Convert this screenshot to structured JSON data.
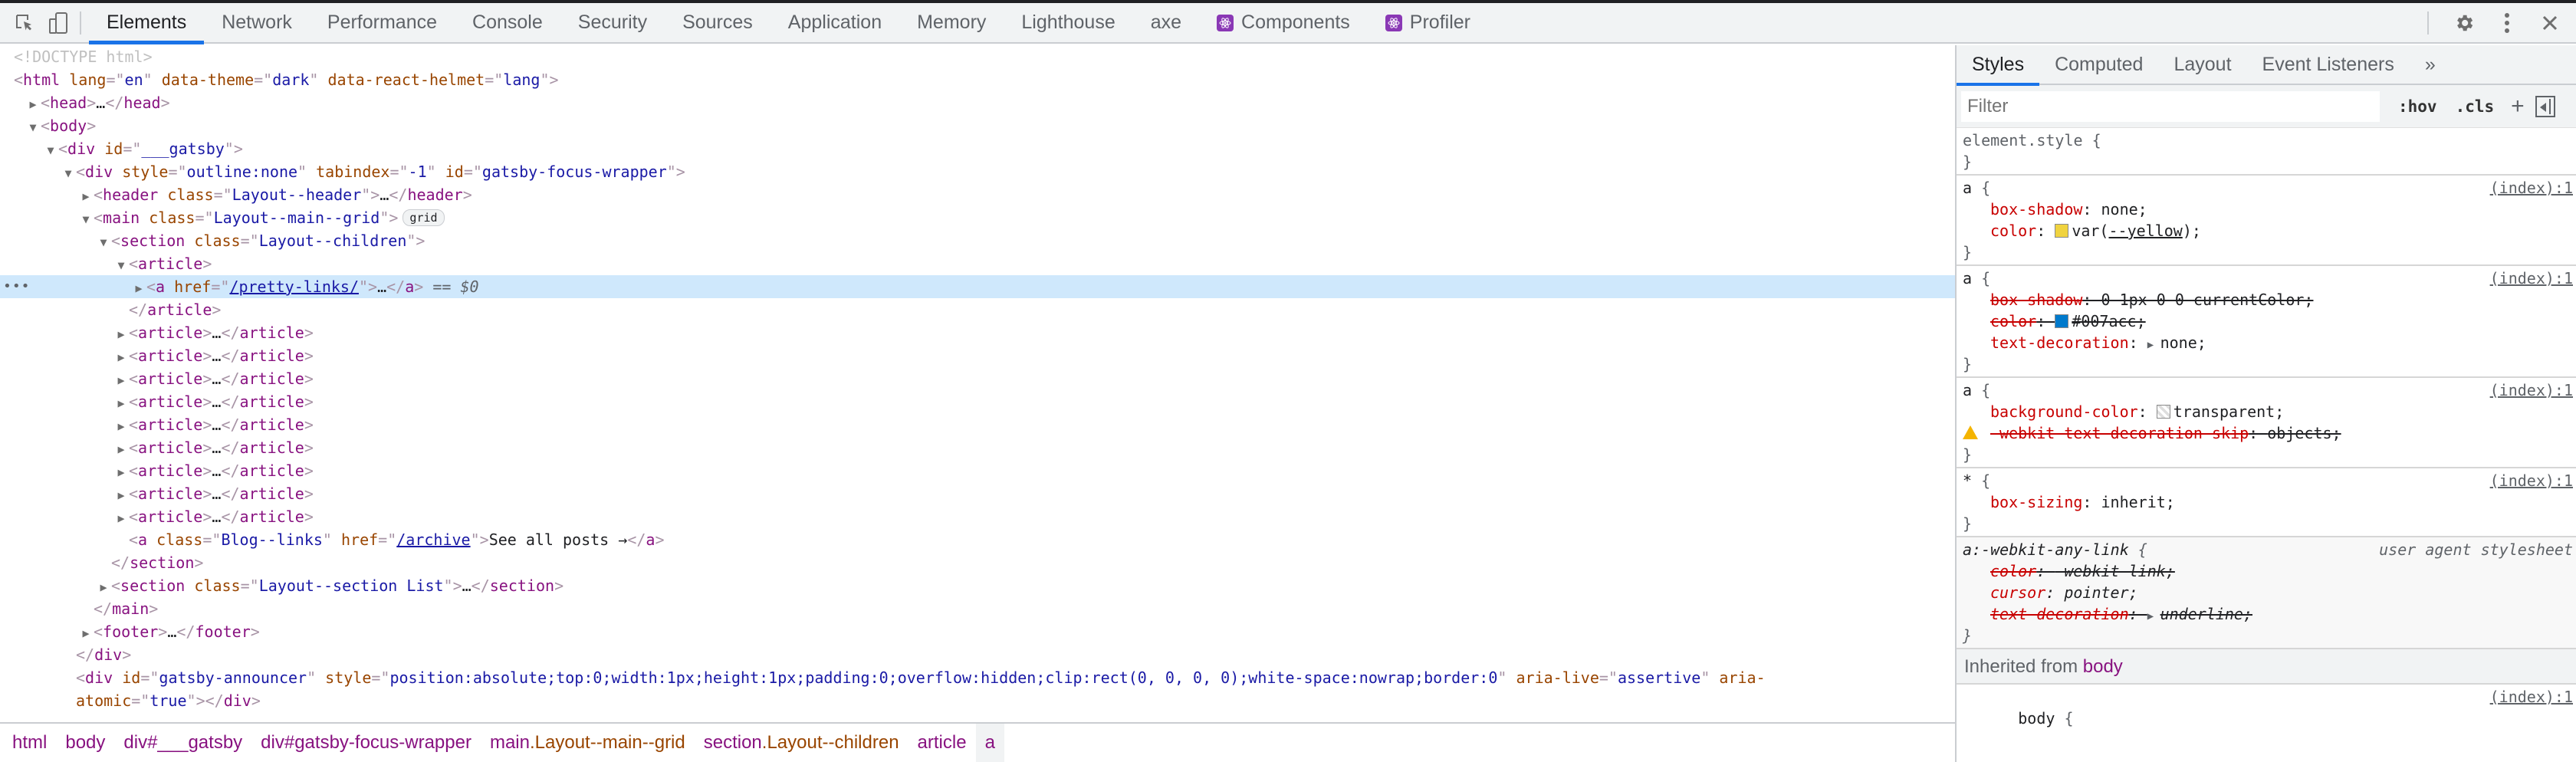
{
  "toolbar": {
    "inspect_icon": "element-picker-icon",
    "device_icon": "device-toolbar-icon",
    "tabs": [
      {
        "label": "Elements",
        "active": true
      },
      {
        "label": "Network"
      },
      {
        "label": "Performance"
      },
      {
        "label": "Console"
      },
      {
        "label": "Security"
      },
      {
        "label": "Sources"
      },
      {
        "label": "Application"
      },
      {
        "label": "Memory"
      },
      {
        "label": "Lighthouse"
      },
      {
        "label": "axe"
      },
      {
        "label": "Components",
        "icon": "react-icon"
      },
      {
        "label": "Profiler",
        "icon": "react-icon"
      }
    ],
    "right_icons": [
      "gear-icon",
      "kebab-menu-icon",
      "close-icon"
    ]
  },
  "elements": {
    "doctype": "<!DOCTYPE html>",
    "html_tag": {
      "name": "html",
      "attrs": [
        {
          "n": "lang",
          "v": "en"
        },
        {
          "n": "data-theme",
          "v": "dark"
        },
        {
          "n": "data-react-helmet",
          "v": "lang"
        }
      ]
    },
    "head": "head",
    "body": "body",
    "gatsby_div": {
      "name": "div",
      "attr_n": "id",
      "attr_v": "___gatsby"
    },
    "focus_wrapper": {
      "name": "div",
      "attrs": [
        {
          "n": "style",
          "v": "outline:none"
        },
        {
          "n": "tabindex",
          "v": "-1"
        },
        {
          "n": "id",
          "v": "gatsby-focus-wrapper"
        }
      ]
    },
    "header": {
      "name": "header",
      "attr_n": "class",
      "attr_v": "Layout--header"
    },
    "main": {
      "name": "main",
      "attr_n": "class",
      "attr_v": "Layout--main--grid",
      "badge": "grid"
    },
    "section": {
      "name": "section",
      "attr_n": "class",
      "attr_v": "Layout--children"
    },
    "article": "article",
    "selected_link": {
      "name": "a",
      "attr_n": "href",
      "attr_v": "/pretty-links/",
      "marker": "== $0"
    },
    "collapsed_article_count": 9,
    "blog_link": {
      "name": "a",
      "class_v": "Blog--links",
      "href_v": "/archive",
      "text": "See all posts →"
    },
    "section_list": {
      "name": "section",
      "attr_n": "class",
      "attr_v": "Layout--section List"
    },
    "footer": "footer",
    "announcer": {
      "id": "gatsby-announcer",
      "style": "position:absolute;top:0;width:1px;height:1px;padding:0;overflow:hidden;clip:rect(0, 0, 0, 0);white-space:nowrap;border:0",
      "aria_live": "assertive",
      "aria_atomic": "true"
    },
    "ellipsis": "…",
    "row_dots": "•••"
  },
  "breadcrumbs": [
    {
      "tag": "html"
    },
    {
      "tag": "body"
    },
    {
      "tag": "div#___gatsby"
    },
    {
      "tag": "div#gatsby-focus-wrapper"
    },
    {
      "tag": "main",
      "cls": ".Layout--main--grid"
    },
    {
      "tag": "section",
      "cls": ".Layout--children"
    },
    {
      "tag": "article"
    },
    {
      "tag": "a",
      "active": true
    }
  ],
  "styles": {
    "tabs": [
      {
        "label": "Styles",
        "active": true
      },
      {
        "label": "Computed"
      },
      {
        "label": "Layout"
      },
      {
        "label": "Event Listeners"
      },
      {
        "label": "»"
      }
    ],
    "filter_placeholder": "Filter",
    "hov": ":hov",
    "cls": ".cls",
    "plus": "+",
    "element_style": "element.style {",
    "source": "(index):1",
    "rules": [
      {
        "selector": "a",
        "props": [
          {
            "name": "box-shadow",
            "value": "none;"
          },
          {
            "name": "color",
            "value": "var(--yellow);",
            "swatch": "#f0d33f",
            "var": "--yellow"
          }
        ]
      },
      {
        "selector": "a",
        "props": [
          {
            "name": "box-shadow",
            "value": "0 1px 0 0 currentColor;",
            "struck": true
          },
          {
            "name": "color",
            "value": "#007acc;",
            "swatch": "#007acc",
            "struck": true
          },
          {
            "name": "text-decoration",
            "value": "none;",
            "expandable": true
          }
        ]
      },
      {
        "selector": "a",
        "props": [
          {
            "name": "background-color",
            "value": "transparent;",
            "swatch": "transparent"
          },
          {
            "name": "-webkit-text-decoration-skip",
            "value": "objects;",
            "struck": true,
            "warning": true
          }
        ]
      },
      {
        "selector": "*",
        "props": [
          {
            "name": "box-sizing",
            "value": "inherit;"
          }
        ]
      }
    ],
    "ua_rule": {
      "selector": "a:-webkit-any-link",
      "source": "user agent stylesheet",
      "props": [
        {
          "name": "color",
          "value": "-webkit-link;",
          "struck": true
        },
        {
          "name": "cursor",
          "value": "pointer;"
        },
        {
          "name": "text-decoration",
          "value": "underline;",
          "struck": true,
          "expandable": true
        }
      ]
    },
    "inherited_label": "Inherited from",
    "inherited_tag": "body",
    "body_rule_selector": "body"
  },
  "colors": {
    "accent": "#1a73e8",
    "tag": "#881280",
    "attr_name": "#994500",
    "attr_value": "#1a1aa6",
    "selected_row": "#cfe8fc",
    "prop_name": "#c80000"
  }
}
